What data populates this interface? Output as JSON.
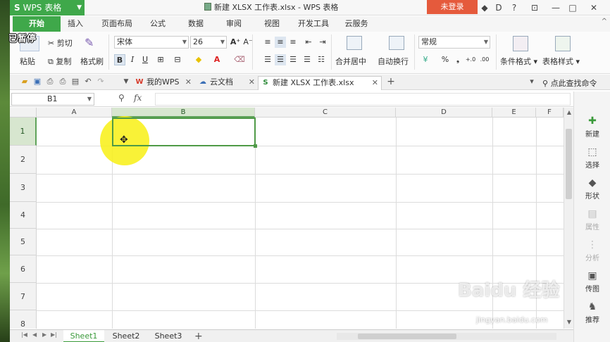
{
  "overlay": {
    "paused_label": "已暂停"
  },
  "titlebar": {
    "app_name": "WPS 表格",
    "doc_title": "新建 XLSX 工作表.xlsx - WPS 表格",
    "login_label": "未登录",
    "skin_icon": "◆",
    "d_icon": "D",
    "help_icon": "?",
    "restore_icon": "⊡",
    "minimize_icon": "—",
    "maximize_icon": "□",
    "close_icon": "✕"
  },
  "menu": {
    "tabs": [
      "开始",
      "插入",
      "页面布局",
      "公式",
      "数据",
      "审阅",
      "视图",
      "开发工具",
      "云服务"
    ],
    "expand_icon": "^"
  },
  "ribbon": {
    "paste_label": "粘贴",
    "cut_label": "剪切",
    "copy_label": "复制",
    "format_painter_label": "格式刷",
    "font_name": "宋体",
    "font_size": "26",
    "grow_font": "A⁺",
    "shrink_font": "A⁻",
    "bold": "B",
    "italic": "I",
    "underline": "U",
    "merge_label": "合并居中",
    "wrap_label": "自动换行",
    "number_format": "常规",
    "percent": "%",
    "comma": "❟",
    "inc_decimal": "+.0",
    "dec_decimal": ".00",
    "conditional_label": "条件格式",
    "table_style_label": "表格样式"
  },
  "doctabs": {
    "tabs": [
      {
        "label": "我的WPS",
        "icon": "W"
      },
      {
        "label": "云文档",
        "icon": "☁"
      },
      {
        "label": "新建 XLSX 工作表.xlsx",
        "icon": "S"
      }
    ],
    "add_icon": "+",
    "find_label": "点此查找命令"
  },
  "formula": {
    "cell_ref": "B1",
    "zoom_icon": "⚲",
    "fx_label": "fx",
    "value": ""
  },
  "grid": {
    "columns": [
      "A",
      "B",
      "C",
      "D",
      "E",
      "F"
    ],
    "rows": [
      "1",
      "2",
      "3",
      "4",
      "5",
      "6",
      "7",
      "8"
    ],
    "selected_cell": "B1",
    "cursor_glyph": "✥"
  },
  "side_panel": {
    "items": [
      {
        "label": "新建",
        "icon": "✚",
        "enabled": true
      },
      {
        "label": "选择",
        "icon": "⬚",
        "enabled": true
      },
      {
        "label": "形状",
        "icon": "◆",
        "enabled": true
      },
      {
        "label": "属性",
        "icon": "▤",
        "enabled": false
      },
      {
        "label": "分析",
        "icon": "⋮",
        "enabled": false
      },
      {
        "label": "传图",
        "icon": "▣",
        "enabled": true
      },
      {
        "label": "推荐",
        "icon": "♞",
        "enabled": true
      }
    ]
  },
  "sheets": {
    "tabs": [
      "Sheet1",
      "Sheet2",
      "Sheet3"
    ],
    "active": "Sheet1",
    "add_icon": "+"
  },
  "watermark": {
    "brand": "Baidu 经验",
    "url": "jingyan.baidu.com"
  }
}
